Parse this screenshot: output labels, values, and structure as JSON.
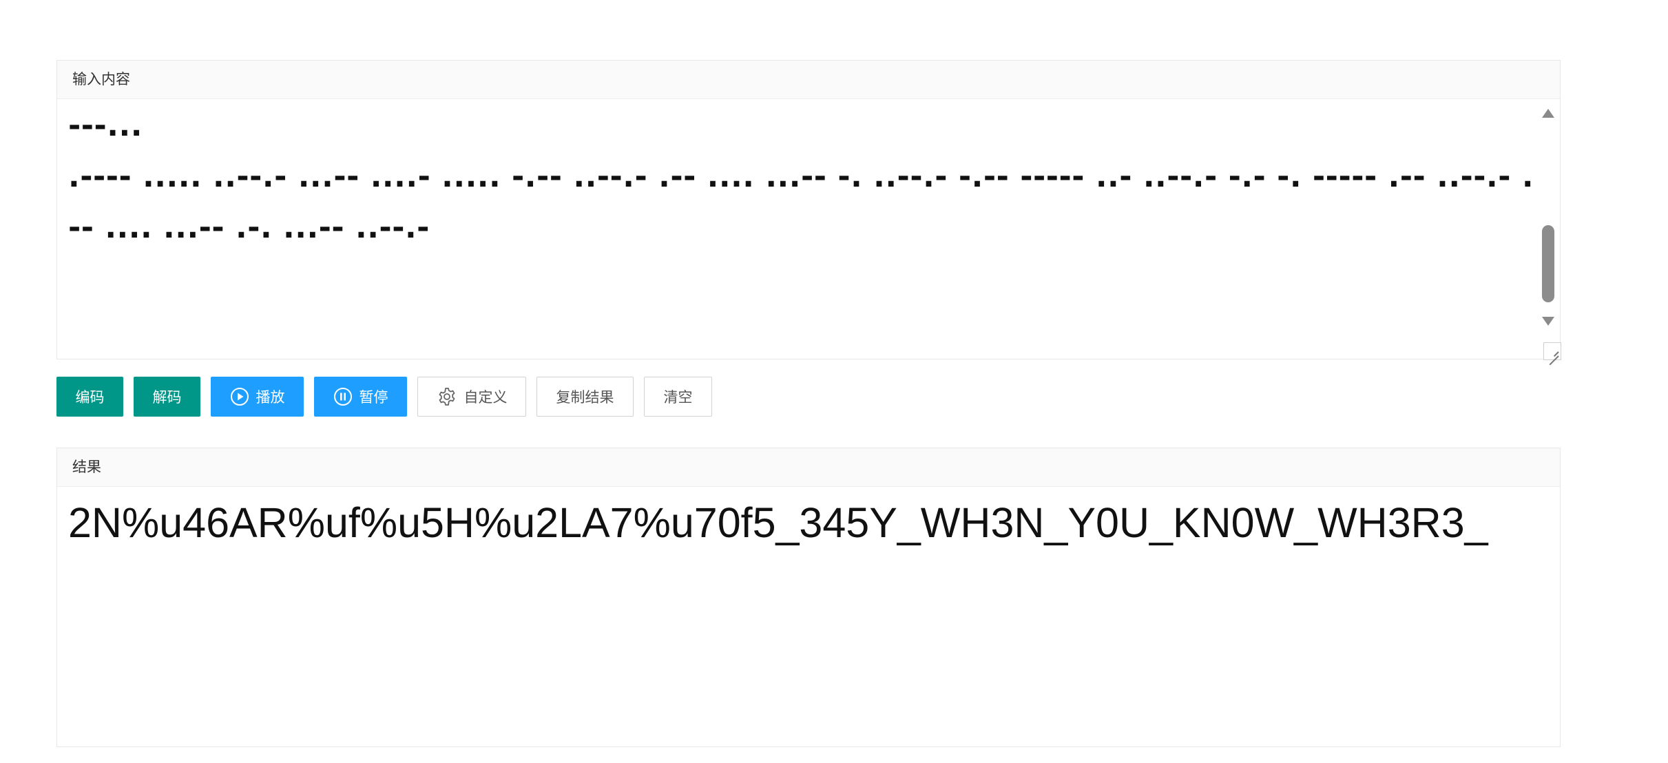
{
  "input_panel": {
    "title": "输入内容",
    "content": "---...\n.---- ..... ..--.- ...-- ....- ..... -.-- ..--.- .-- .... ...-- -. ..--.- -.-- ----- ..- ..--.- -.- -. ----- .-- ..--.- .-- .... ...-- .-. ...-- ..--.-"
  },
  "toolbar": {
    "encode_label": "编码",
    "decode_label": "解码",
    "play_label": "播放",
    "pause_label": "暂停",
    "custom_label": "自定义",
    "copy_label": "复制结果",
    "clear_label": "清空"
  },
  "result_panel": {
    "title": "结果",
    "content": "2N%u46AR%uf%u5H%u2LA7%u70f5_345Y_WH3N_Y0U_KN0W_WH3R3_"
  },
  "colors": {
    "green_button": "#009688",
    "blue_button": "#1e9fff"
  },
  "icons": {
    "play": "play-circle-icon",
    "pause": "pause-circle-icon",
    "custom": "gear-icon"
  }
}
